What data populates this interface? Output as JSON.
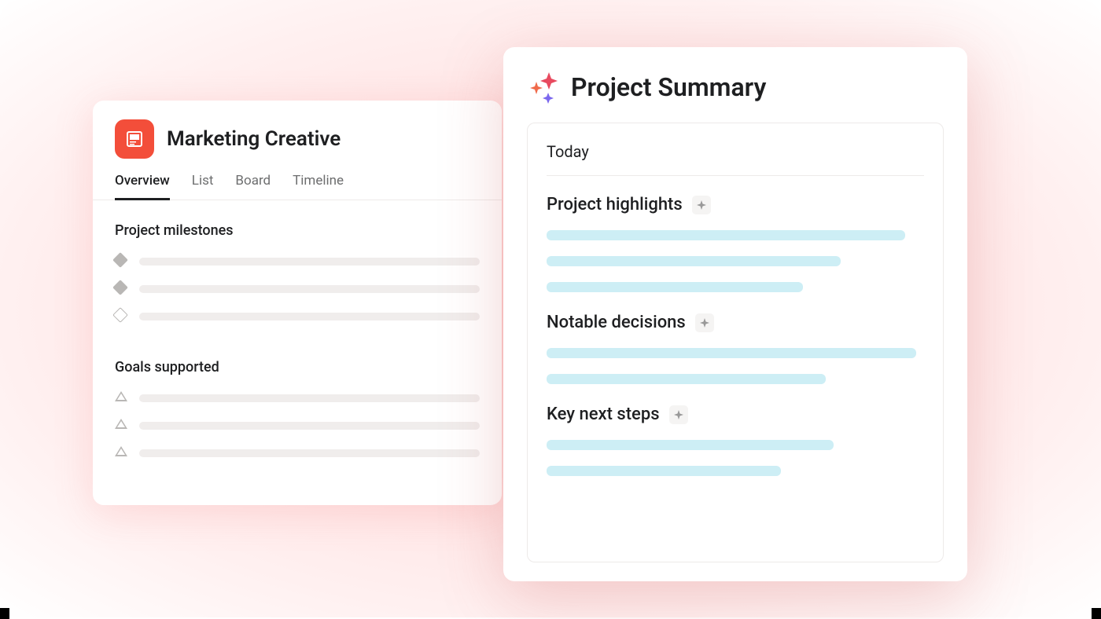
{
  "project": {
    "title": "Marketing Creative",
    "tabs": [
      {
        "label": "Overview",
        "active": true
      },
      {
        "label": "List",
        "active": false
      },
      {
        "label": "Board",
        "active": false
      },
      {
        "label": "Timeline",
        "active": false
      }
    ],
    "sections": {
      "milestones_title": "Project milestones",
      "goals_title": "Goals supported"
    }
  },
  "summary": {
    "title": "Project Summary",
    "date_label": "Today",
    "sections": [
      {
        "title": "Project highlights"
      },
      {
        "title": "Notable decisions"
      },
      {
        "title": "Key next steps"
      }
    ]
  }
}
